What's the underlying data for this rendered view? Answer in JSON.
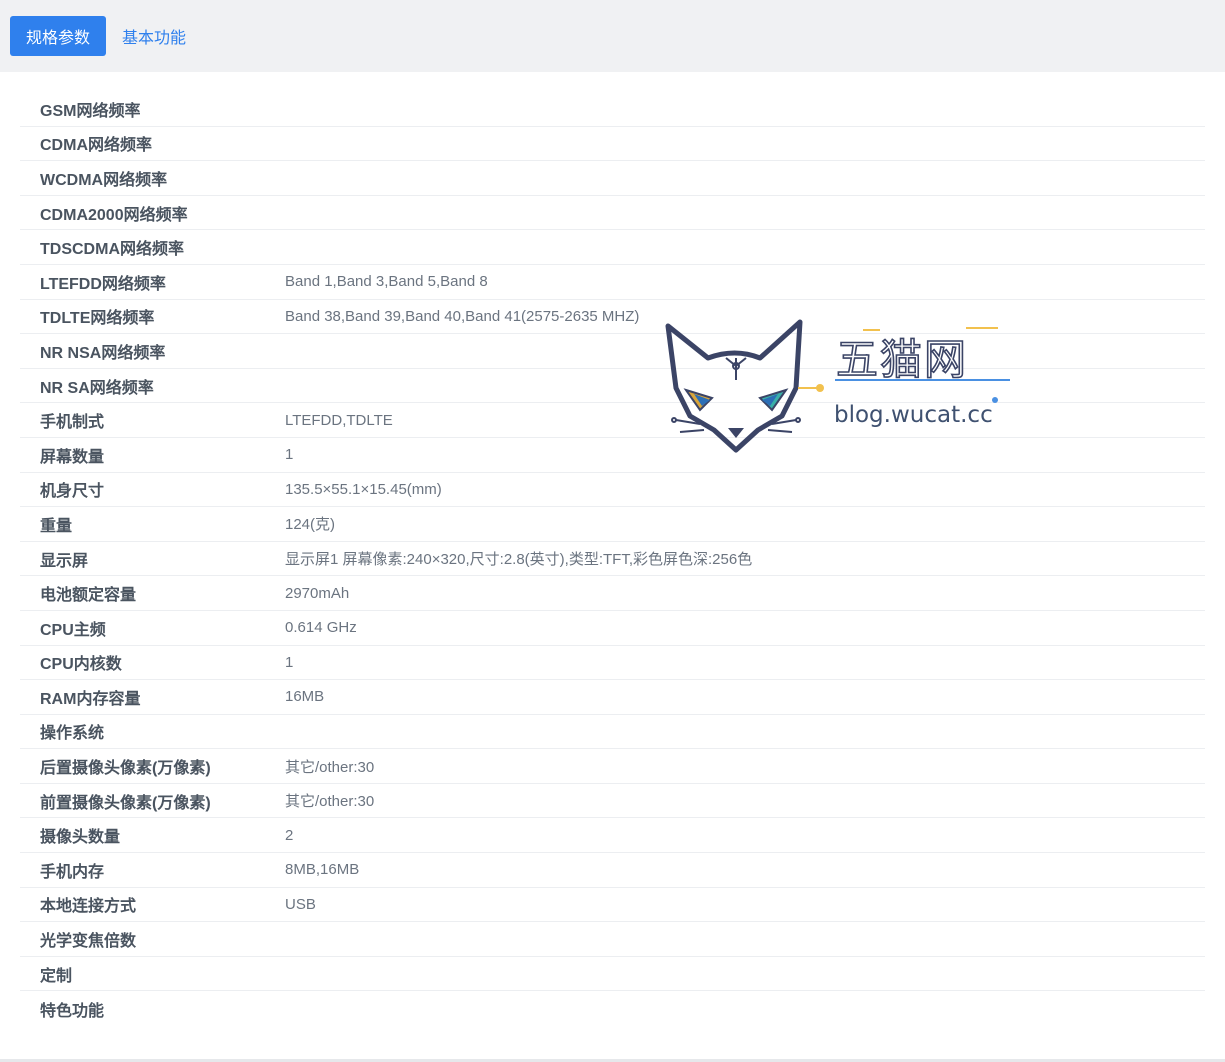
{
  "tabs": [
    {
      "label": "规格参数",
      "active": true
    },
    {
      "label": "基本功能",
      "active": false
    }
  ],
  "specs": [
    {
      "label": "GSM网络频率",
      "value": ""
    },
    {
      "label": "CDMA网络频率",
      "value": ""
    },
    {
      "label": "WCDMA网络频率",
      "value": ""
    },
    {
      "label": "CDMA2000网络频率",
      "value": ""
    },
    {
      "label": "TDSCDMA网络频率",
      "value": ""
    },
    {
      "label": "LTEFDD网络频率",
      "value": "Band 1,Band 3,Band 5,Band 8"
    },
    {
      "label": "TDLTE网络频率",
      "value": "Band 38,Band 39,Band 40,Band 41(2575-2635 MHZ)"
    },
    {
      "label": "NR NSA网络频率",
      "value": ""
    },
    {
      "label": "NR SA网络频率",
      "value": ""
    },
    {
      "label": "手机制式",
      "value": "LTEFDD,TDLTE"
    },
    {
      "label": "屏幕数量",
      "value": "1"
    },
    {
      "label": "机身尺寸",
      "value": "135.5×55.1×15.45(mm)"
    },
    {
      "label": "重量",
      "value": "124(克)"
    },
    {
      "label": "显示屏",
      "value": "显示屏1 屏幕像素:240×320,尺寸:2.8(英寸),类型:TFT,彩色屏色深:256色"
    },
    {
      "label": "电池额定容量",
      "value": "2970mAh"
    },
    {
      "label": "CPU主频",
      "value": "0.614 GHz"
    },
    {
      "label": "CPU内核数",
      "value": "1"
    },
    {
      "label": "RAM内存容量",
      "value": "16MB"
    },
    {
      "label": "操作系统",
      "value": ""
    },
    {
      "label": "后置摄像头像素(万像素)",
      "value": "其它/other:30"
    },
    {
      "label": "前置摄像头像素(万像素)",
      "value": "其它/other:30"
    },
    {
      "label": "摄像头数量",
      "value": "2"
    },
    {
      "label": "手机内存",
      "value": "8MB,16MB"
    },
    {
      "label": "本地连接方式",
      "value": "USB"
    },
    {
      "label": "光学变焦倍数",
      "value": ""
    },
    {
      "label": "定制",
      "value": ""
    },
    {
      "label": "特色功能",
      "value": ""
    }
  ],
  "watermark": {
    "title": "五猫网",
    "url": "blog.wucat.cc",
    "icon": "cat-logo-icon"
  },
  "colors": {
    "accent": "#2f80ed",
    "tabbar_bg": "#f0f1f3",
    "label": "#4a5460",
    "value": "#6b7480"
  }
}
